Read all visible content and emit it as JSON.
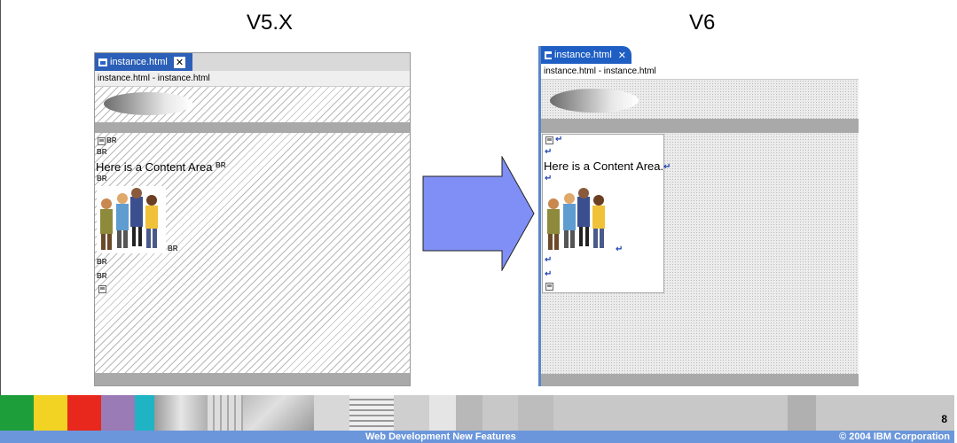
{
  "slide": {
    "left_heading": "V5.X",
    "right_heading": "V6",
    "page_number": "8",
    "footer_title": "Web Development New Features",
    "footer_copyright": "© 2004 IBM Corporation"
  },
  "v5_editor": {
    "tab_label": "instance.html",
    "tab_close": "✕",
    "breadcrumb": "instance.html - instance.html",
    "content_text": "Here is a Content Area",
    "br_marker": "BR",
    "return_marker": "↵",
    "tab_color": "#2b5fb8"
  },
  "v6_editor": {
    "tab_label": "instance.html",
    "tab_close": "✕",
    "breadcrumb": "instance.html - instance.html",
    "content_text": "Here is a Content Area.",
    "return_marker": "↵",
    "tab_color": "#1f5fc4",
    "accent_color": "#5b86c8"
  },
  "arrow_color": "#7f8ff5",
  "footer_colors": [
    "#1e9e3a",
    "#f2d324",
    "#e8281c",
    "#9a7bb6",
    "#1fb4c4"
  ]
}
